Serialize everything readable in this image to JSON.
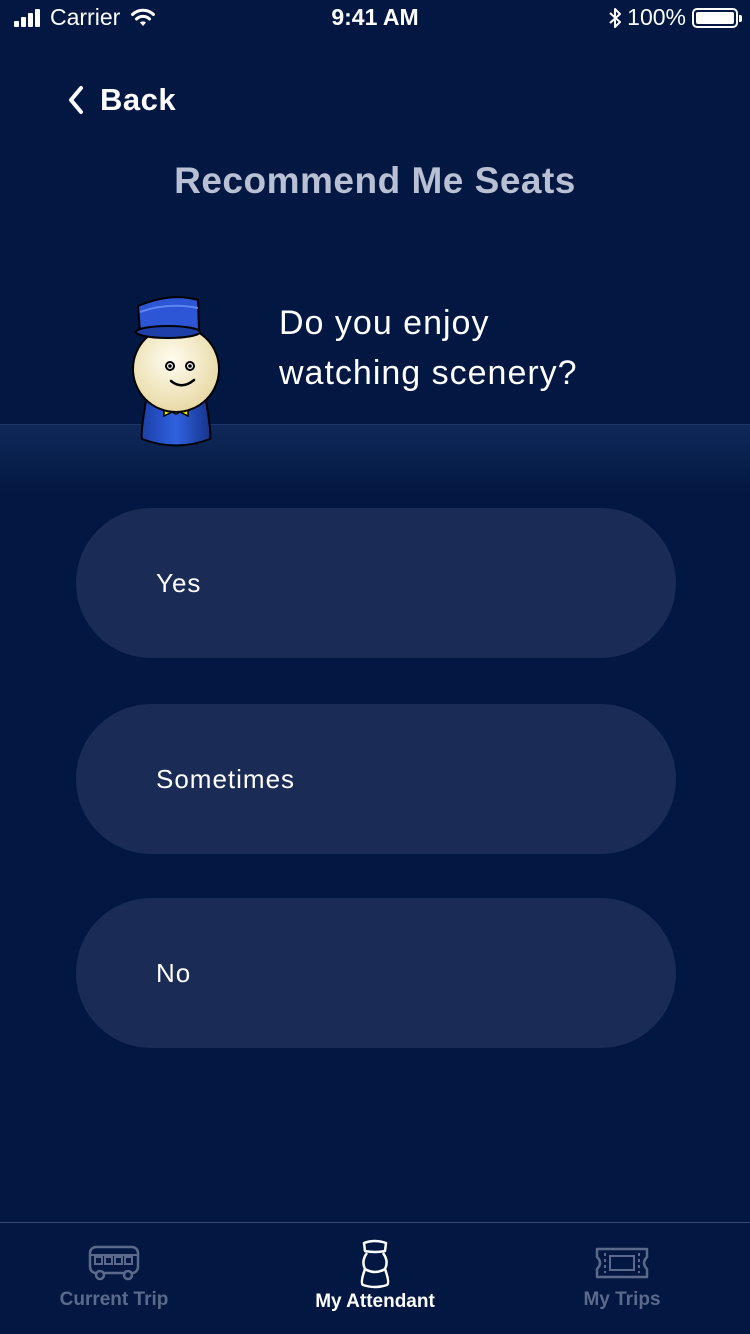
{
  "status_bar": {
    "carrier": "Carrier",
    "time": "9:41 AM",
    "battery": "100%"
  },
  "nav": {
    "back_label": "Back"
  },
  "page": {
    "title": "Recommend Me Seats",
    "question_line1": "Do you enjoy",
    "question_line2": "watching scenery?"
  },
  "options": [
    {
      "label": "Yes"
    },
    {
      "label": "Sometimes"
    },
    {
      "label": "No"
    }
  ],
  "tab_bar": {
    "tabs": [
      {
        "label": "Current Trip",
        "icon": "bus-icon",
        "active": false
      },
      {
        "label": "My Attendant",
        "icon": "attendant-icon",
        "active": true
      },
      {
        "label": "My Trips",
        "icon": "ticket-icon",
        "active": false
      }
    ]
  },
  "colors": {
    "background": "#021842",
    "option_bg": "#1a2b56",
    "title": "#b9c0d3",
    "inactive_tab": "#5b6a8a"
  }
}
